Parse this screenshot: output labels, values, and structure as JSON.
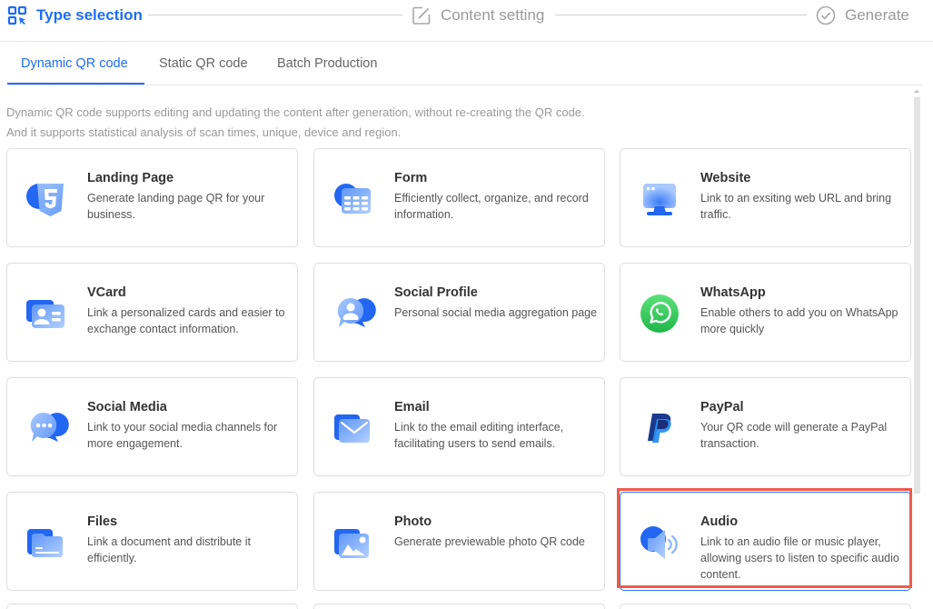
{
  "stepper": {
    "steps": [
      {
        "label": "Type selection",
        "icon": "qr-select-icon",
        "state": "active"
      },
      {
        "label": "Content setting",
        "icon": "edit-icon",
        "state": "inactive"
      },
      {
        "label": "Generate",
        "icon": "check-circle-icon",
        "state": "inactive"
      }
    ]
  },
  "tabs": [
    {
      "label": "Dynamic QR code",
      "active": true
    },
    {
      "label": "Static QR code",
      "active": false
    },
    {
      "label": "Batch Production",
      "active": false
    }
  ],
  "description": {
    "line1": "Dynamic QR code supports editing and updating the content after generation, without re-creating the QR code.",
    "line2": "And it supports statistical analysis of scan times, unique, device and region."
  },
  "cards": [
    {
      "title": "Landing Page",
      "subtitle": "Generate landing page QR for your business.",
      "icon": "html5-icon"
    },
    {
      "title": "Form",
      "subtitle": "Efficiently collect, organize, and record information.",
      "icon": "form-table-icon"
    },
    {
      "title": "Website",
      "subtitle": "Link to an exsiting web URL and bring traffic.",
      "icon": "monitor-icon"
    },
    {
      "title": "VCard",
      "subtitle": "Link a personalized cards and easier to exchange contact information.",
      "icon": "contact-card-icon"
    },
    {
      "title": "Social Profile",
      "subtitle": "Personal social media aggregation page",
      "icon": "profile-chat-icon"
    },
    {
      "title": "WhatsApp",
      "subtitle": "Enable others to add you on WhatsApp more quickly",
      "icon": "whatsapp-icon"
    },
    {
      "title": "Social Media",
      "subtitle": "Link to your social media channels for more engagement.",
      "icon": "chat-bubbles-icon"
    },
    {
      "title": "Email",
      "subtitle": "Link to the email editing interface, facilitating users to send emails.",
      "icon": "envelope-icon"
    },
    {
      "title": "PayPal",
      "subtitle": "Your QR code will generate a PayPal transaction.",
      "icon": "paypal-icon"
    },
    {
      "title": "Files",
      "subtitle": "Link a document and distribute it efficiently.",
      "icon": "folder-icon"
    },
    {
      "title": "Photo",
      "subtitle": "Generate previewable photo QR code",
      "icon": "photo-icon"
    },
    {
      "title": "Audio",
      "subtitle": "Link to an audio file or music player, allowing users to listen to specific audio content.",
      "icon": "speaker-icon",
      "selected": true
    }
  ],
  "colors": {
    "accent": "#1f6df5",
    "highlight": "#ee5b4f",
    "whatsapp": "#25c150"
  }
}
